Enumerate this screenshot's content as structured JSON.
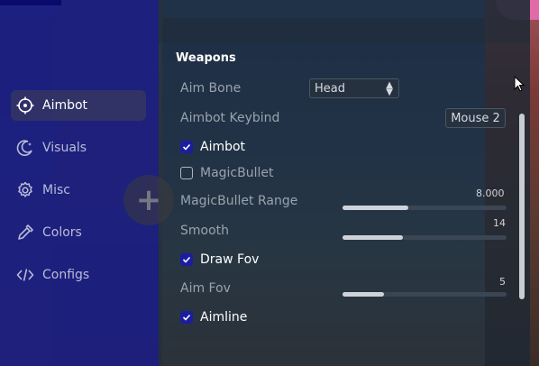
{
  "sidebar": {
    "items": [
      {
        "label": "Aimbot",
        "icon": "crosshair-icon",
        "active": true
      },
      {
        "label": "Visuals",
        "icon": "moon-icon",
        "active": false
      },
      {
        "label": "Misc",
        "icon": "gear-icon",
        "active": false
      },
      {
        "label": "Colors",
        "icon": "pipette-icon",
        "active": false
      },
      {
        "label": "Configs",
        "icon": "code-icon",
        "active": false
      }
    ]
  },
  "weapons": {
    "section_title": "Weapons",
    "aim_bone": {
      "label": "Aim Bone",
      "value": "Head"
    },
    "aimbot_keybind": {
      "label": "Aimbot Keybind",
      "value": "Mouse 2"
    },
    "aimbot": {
      "label": "Aimbot",
      "checked": true
    },
    "magic_bullet": {
      "label": "MagicBullet",
      "checked": false
    },
    "magic_bullet_range": {
      "label": "MagicBullet Range",
      "value": "8.000",
      "fill_fraction": 0.4
    },
    "smooth": {
      "label": "Smooth",
      "value": "14",
      "fill_fraction": 0.37
    },
    "draw_fov": {
      "label": "Draw Fov",
      "checked": true
    },
    "aim_fov": {
      "label": "Aim Fov",
      "value": "5",
      "fill_fraction": 0.25
    },
    "aimline": {
      "label": "Aimline",
      "checked": true
    }
  },
  "colors": {
    "accent": "#1c1ca0",
    "sidebar_bg": "#1c1c8c",
    "panel_bg": "#1c2834",
    "text_primary": "#ffffff",
    "text_muted": "#9aa3ad"
  }
}
